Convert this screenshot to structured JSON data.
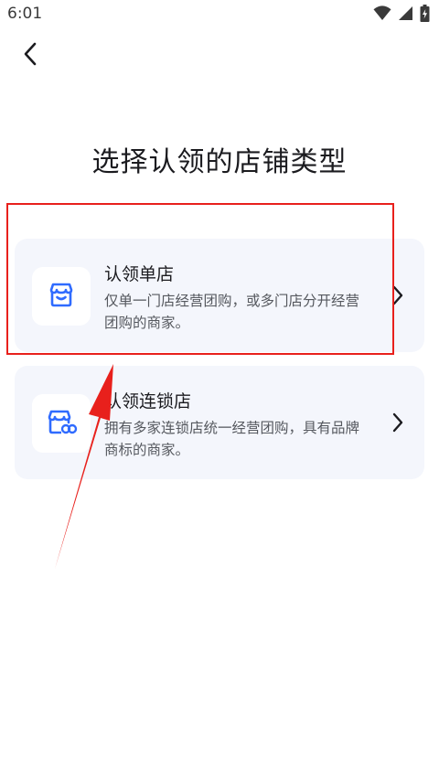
{
  "status_bar": {
    "time": "6:01",
    "icons": [
      "wifi-icon",
      "cellular-signal-icon",
      "battery-charging-icon"
    ]
  },
  "header": {
    "back_icon": "chevron-left-icon"
  },
  "page": {
    "title": "选择认领的店铺类型"
  },
  "store_types": [
    {
      "icon": "storefront-icon",
      "title": "认领单店",
      "description": "仅单一门店经营团购，或多门店分开经营团购的商家。"
    },
    {
      "icon": "chain-store-icon",
      "title": "认领连锁店",
      "description": "拥有多家连锁店统一经营团购，具有品牌商标的商家。"
    }
  ],
  "colors": {
    "accent_blue": "#2f6bff",
    "card_background": "#f4f6fc",
    "annotation_red": "#e8201c"
  }
}
